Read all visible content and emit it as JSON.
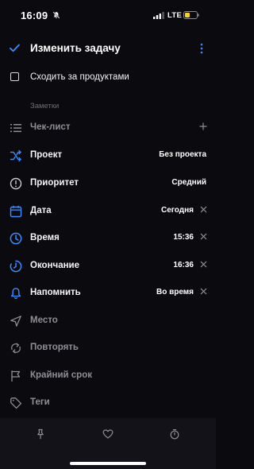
{
  "status": {
    "time": "16:09",
    "network": "LTE"
  },
  "header": {
    "title": "Изменить задачу"
  },
  "task": {
    "title": "Сходить за продуктами"
  },
  "notes": {
    "label": "Заметки"
  },
  "fields": {
    "checklist": {
      "label": "Чек-лист"
    },
    "project": {
      "label": "Проект",
      "value": "Без проекта"
    },
    "priority": {
      "label": "Приоритет",
      "value": "Средний"
    },
    "date": {
      "label": "Дата",
      "value": "Сегодня"
    },
    "time": {
      "label": "Время",
      "value": "15:36"
    },
    "end": {
      "label": "Окончание",
      "value": "16:36"
    },
    "remind": {
      "label": "Напомнить",
      "value": "Во время"
    },
    "place": {
      "label": "Место"
    },
    "repeat": {
      "label": "Повторять"
    },
    "deadline": {
      "label": "Крайний срок"
    },
    "tags": {
      "label": "Теги"
    }
  },
  "colors": {
    "accent": "#3d8bff",
    "background": "#0b0b0f",
    "muted": "#8e8e95",
    "battery": "#ffd60a"
  },
  "bottom_bar": {
    "icons": [
      "pin-icon",
      "heart-icon",
      "timer-icon"
    ]
  }
}
